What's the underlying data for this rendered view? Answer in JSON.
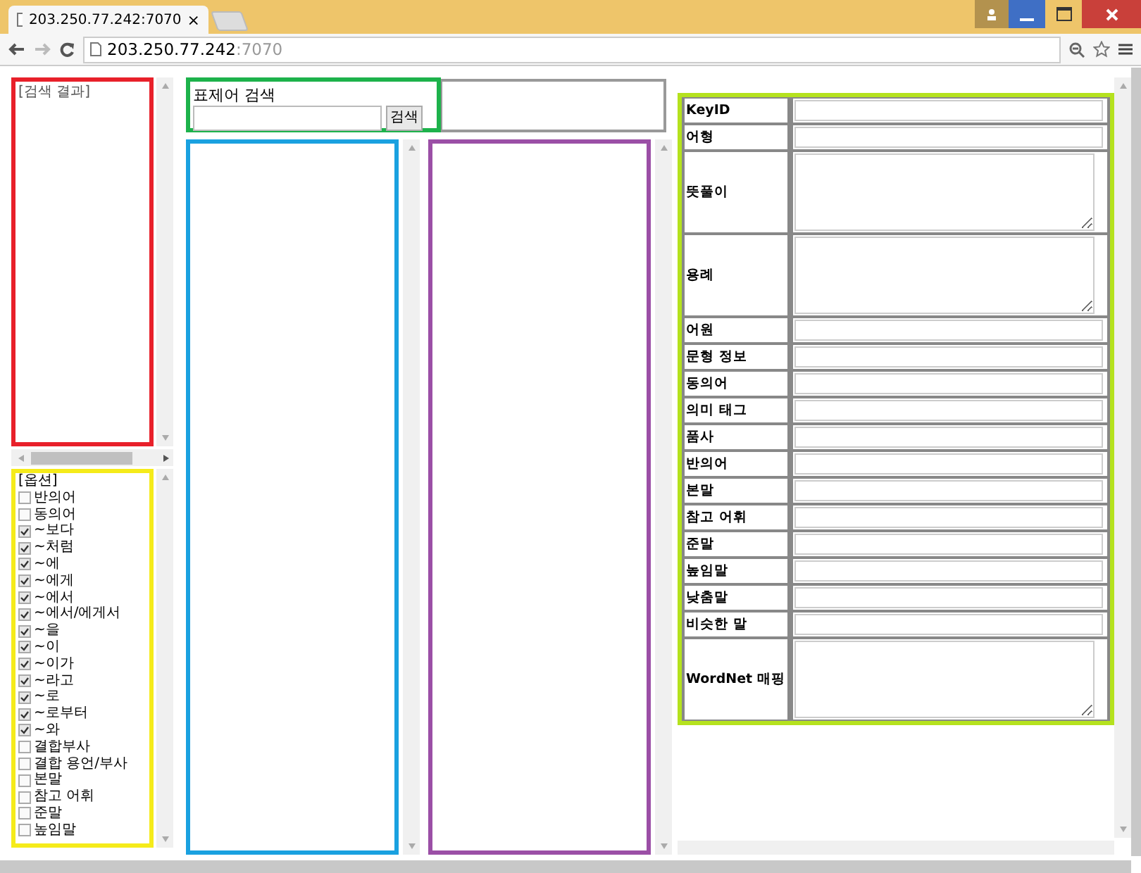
{
  "browser": {
    "tab_title": "203.250.77.242:7070",
    "tab_close": "×",
    "url_host": "203.250.77.242",
    "url_port": ":7070"
  },
  "results": {
    "title": "[검색 결과]"
  },
  "options": {
    "title": "[옵션]",
    "items": [
      {
        "label": "반의어",
        "checked": false
      },
      {
        "label": "동의어",
        "checked": false
      },
      {
        "label": "~보다",
        "checked": true
      },
      {
        "label": "~처럼",
        "checked": true
      },
      {
        "label": "~에",
        "checked": true
      },
      {
        "label": "~에게",
        "checked": true
      },
      {
        "label": "~에서",
        "checked": true
      },
      {
        "label": "~에서/에게서",
        "checked": true
      },
      {
        "label": "~을",
        "checked": true
      },
      {
        "label": "~이",
        "checked": true
      },
      {
        "label": "~이가",
        "checked": true
      },
      {
        "label": "~라고",
        "checked": true
      },
      {
        "label": "~로",
        "checked": true
      },
      {
        "label": "~로부터",
        "checked": true
      },
      {
        "label": "~와",
        "checked": true
      },
      {
        "label": "결합부사",
        "checked": false
      },
      {
        "label": "결합 용언/부사",
        "checked": false
      },
      {
        "label": "본말",
        "checked": false
      },
      {
        "label": "참고 어휘",
        "checked": false
      },
      {
        "label": "준말",
        "checked": false
      },
      {
        "label": "높임말",
        "checked": false
      }
    ]
  },
  "search": {
    "label": "표제어 검색",
    "button": "검색"
  },
  "fields": [
    {
      "label": "KeyID",
      "kind": "input"
    },
    {
      "label": "어형",
      "kind": "input"
    },
    {
      "label": "뜻풀이",
      "kind": "textarea"
    },
    {
      "label": "용례",
      "kind": "textarea"
    },
    {
      "label": "어원",
      "kind": "input"
    },
    {
      "label": "문형 정보",
      "kind": "input"
    },
    {
      "label": "동의어",
      "kind": "input"
    },
    {
      "label": "의미 태그",
      "kind": "input"
    },
    {
      "label": "품사",
      "kind": "input"
    },
    {
      "label": "반의어",
      "kind": "input"
    },
    {
      "label": "본말",
      "kind": "input"
    },
    {
      "label": "참고 어휘",
      "kind": "input"
    },
    {
      "label": "준말",
      "kind": "input"
    },
    {
      "label": "높임말",
      "kind": "input"
    },
    {
      "label": "낮춤말",
      "kind": "input"
    },
    {
      "label": "비슷한 말",
      "kind": "input"
    },
    {
      "label": "WordNet 매핑",
      "kind": "textarea"
    }
  ]
}
